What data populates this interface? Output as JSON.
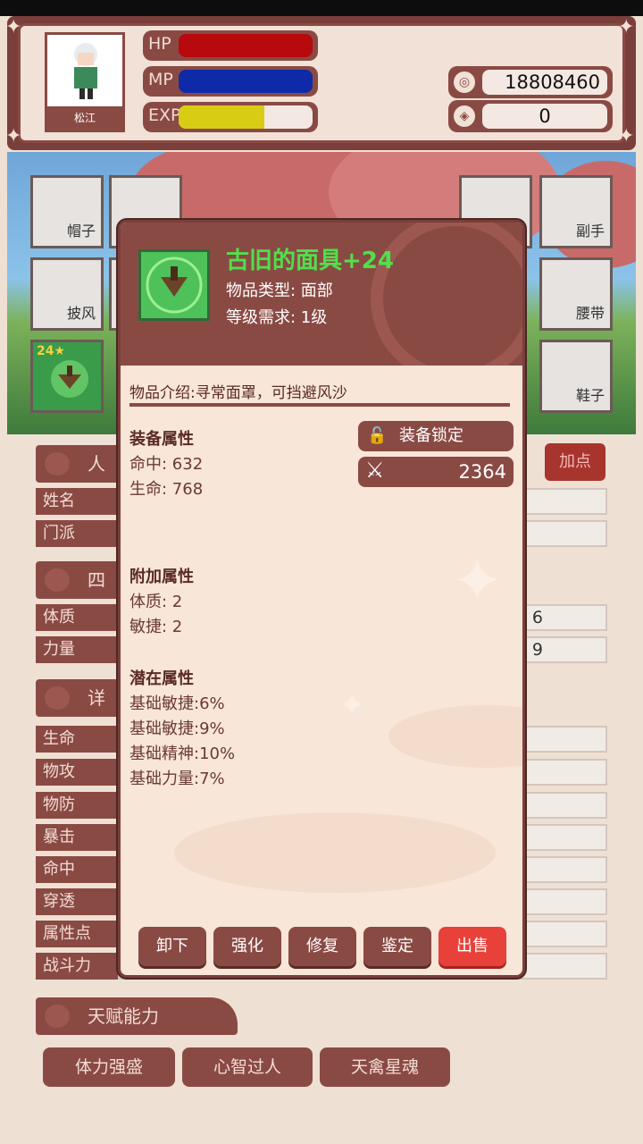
{
  "header": {
    "character_name": "松江",
    "bars": [
      {
        "label": "HP",
        "fill": 1.0,
        "color": "#b8090c"
      },
      {
        "label": "MP",
        "fill": 1.0,
        "color": "#0f2aa8"
      },
      {
        "label": "EXP",
        "fill": 0.64,
        "color": "#d9cc14"
      }
    ],
    "currency": [
      {
        "icon": "coin-icon",
        "value": "18808460"
      },
      {
        "icon": "gem-icon",
        "value": "0"
      }
    ]
  },
  "equipment_slots": {
    "left": [
      "帽子",
      "披风",
      ""
    ],
    "right": [
      "副手",
      "腰带",
      "鞋子"
    ],
    "equipped_level": "24★"
  },
  "panel": {
    "section_basic": "人",
    "rows_basic": [
      "姓名",
      "门派"
    ],
    "section_four": "四",
    "rows_four": [
      "体质",
      "力量"
    ],
    "rows_four_values": [
      "6",
      "9"
    ],
    "section_detail": "详",
    "rows_detail": [
      "生命",
      "物攻",
      "物防",
      "暴击",
      "命中",
      "穿透",
      "属性点",
      "战斗力"
    ],
    "add_points_label": "加点",
    "talent_title": "天赋能力",
    "talents": [
      "体力强盛",
      "心智过人",
      "天禽星魂"
    ]
  },
  "item": {
    "name": "古旧的面具+24",
    "type_line": "物品类型: 面部",
    "level_line": "等级需求: 1级",
    "intro": "物品介绍:寻常面罩，可挡避风沙",
    "equip_attr_title": "装备属性",
    "equip_attrs": [
      "命中: 632",
      "生命: 768"
    ],
    "lock_label": "装备锁定",
    "combat_power": "2364",
    "extra_attr_title": "附加属性",
    "extra_attrs": [
      "体质: 2",
      "敏捷: 2"
    ],
    "latent_attr_title": "潜在属性",
    "latent_attrs": [
      "基础敏捷:6%",
      "基础敏捷:9%",
      "基础精神:10%",
      "基础力量:7%"
    ],
    "actions": [
      "卸下",
      "强化",
      "修复",
      "鉴定",
      "出售"
    ]
  }
}
